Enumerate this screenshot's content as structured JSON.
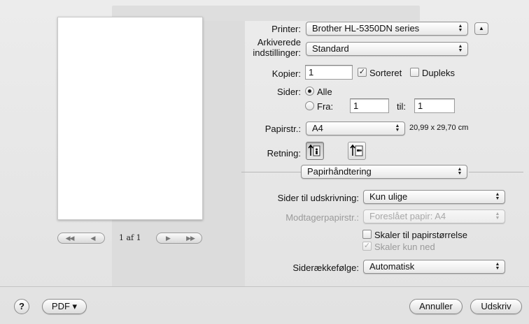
{
  "printer": {
    "label": "Printer:",
    "value": "Brother HL-5350DN series"
  },
  "presets": {
    "label_line1": "Arkiverede",
    "label_line2": "indstillinger:",
    "value": "Standard"
  },
  "copies": {
    "label": "Kopier:",
    "value": "1",
    "collate_label": "Sorteret",
    "collate_checked": true,
    "duplex_label": "Dupleks",
    "duplex_checked": false
  },
  "pages": {
    "label": "Sider:",
    "all_label": "Alle",
    "from_label": "Fra:",
    "from_value": "1",
    "to_label": "til:",
    "to_value": "1",
    "selected": "all"
  },
  "paper_size": {
    "label": "Papirstr.:",
    "value": "A4",
    "dimensions": "20,99 x 29,70 cm"
  },
  "orientation": {
    "label": "Retning:",
    "selected": "portrait"
  },
  "section": {
    "value": "Papirhåndtering"
  },
  "pages_to_print": {
    "label": "Sider til udskrivning:",
    "value": "Kun ulige"
  },
  "destination_paper": {
    "label": "Modtagerpapirstr.:",
    "value": "Foreslået papir: A4",
    "disabled": true
  },
  "scale_to_fit": {
    "label": "Skaler til papirstørrelse",
    "checked": false
  },
  "scale_down_only": {
    "label": "Skaler kun ned",
    "checked": true,
    "disabled": true
  },
  "page_order": {
    "label": "Siderækkefølge:",
    "value": "Automatisk"
  },
  "preview_nav": {
    "page_indicator": "1 af 1"
  },
  "footer": {
    "help": "?",
    "pdf_label": "PDF ▾",
    "cancel_label": "Annuller",
    "print_label": "Udskriv"
  },
  "colors": {
    "window_bg": "#e8e8e8",
    "control_border": "#8f8f8f",
    "disabled_text": "#9a9a9a"
  }
}
